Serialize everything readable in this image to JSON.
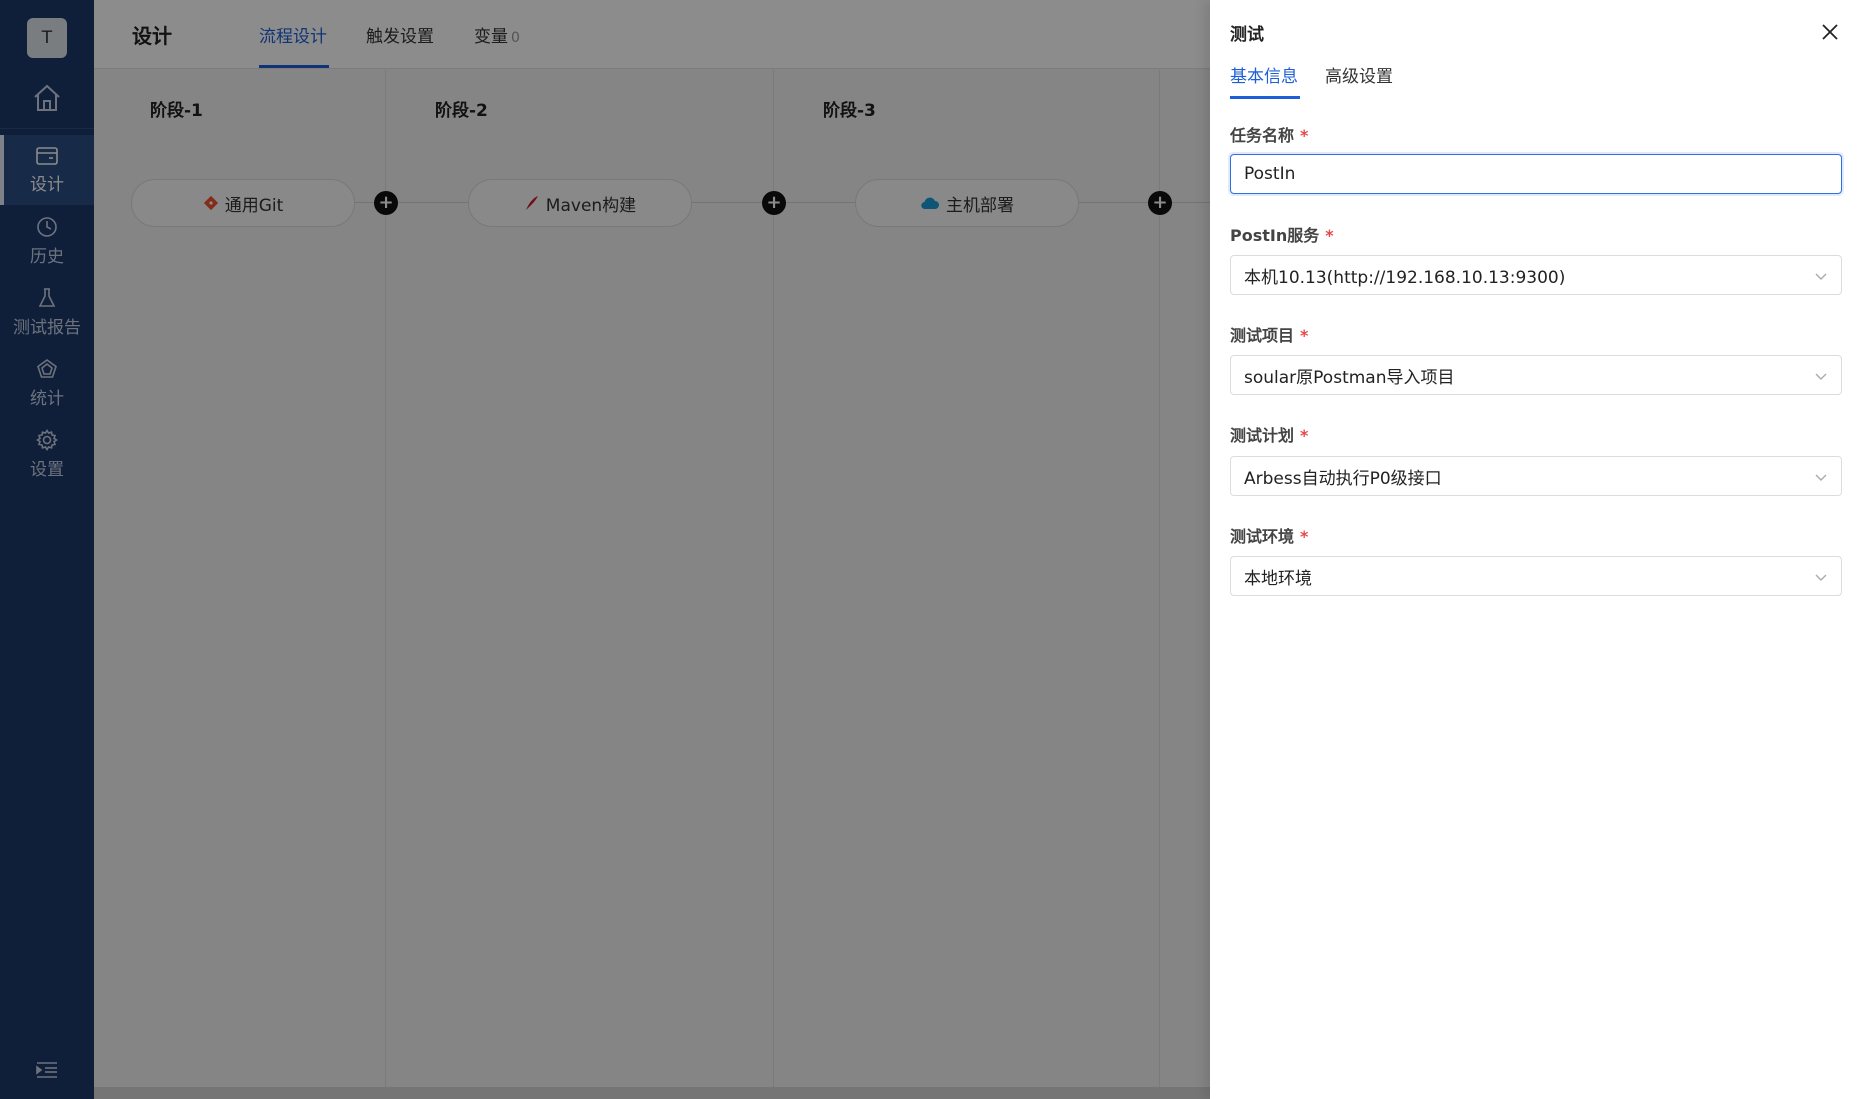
{
  "sidebar": {
    "avatar_letter": "T",
    "items": [
      {
        "label": "设计",
        "icon": "design-icon",
        "active": true
      },
      {
        "label": "历史",
        "icon": "clock-icon"
      },
      {
        "label": "测试报告",
        "icon": "flask-icon"
      },
      {
        "label": "统计",
        "icon": "chart-icon"
      },
      {
        "label": "设置",
        "icon": "gear-icon"
      }
    ]
  },
  "header": {
    "title": "设计",
    "tabs": [
      {
        "label": "流程设计",
        "active": true
      },
      {
        "label": "触发设置"
      },
      {
        "label": "变量",
        "count": "0"
      }
    ]
  },
  "pipeline": {
    "stages": [
      {
        "title": "阶段-1",
        "task": "通用Git",
        "task_icon": "git-icon"
      },
      {
        "title": "阶段-2",
        "task": "Maven构建",
        "task_icon": "maven-icon"
      },
      {
        "title": "阶段-3",
        "task": "主机部署",
        "task_icon": "cloud-icon"
      }
    ],
    "add_symbol": "+"
  },
  "drawer": {
    "title": "测试",
    "tabs": [
      {
        "label": "基本信息",
        "active": true
      },
      {
        "label": "高级设置"
      }
    ],
    "required_mark": "*",
    "fields": {
      "task_name": {
        "label": "任务名称",
        "value": "PostIn"
      },
      "service": {
        "label": "PostIn服务",
        "value": "本机10.13(http://192.168.10.13:9300)"
      },
      "project": {
        "label": "测试项目",
        "value": "soular原Postman导入项目"
      },
      "plan": {
        "label": "测试计划",
        "value": "Arbess自动执行P0级接口"
      },
      "env": {
        "label": "测试环境",
        "value": "本地环境"
      }
    }
  },
  "colors": {
    "sidebar_bg": "#1c3a6b",
    "accent": "#1d5fd8",
    "required": "#e5484d"
  }
}
